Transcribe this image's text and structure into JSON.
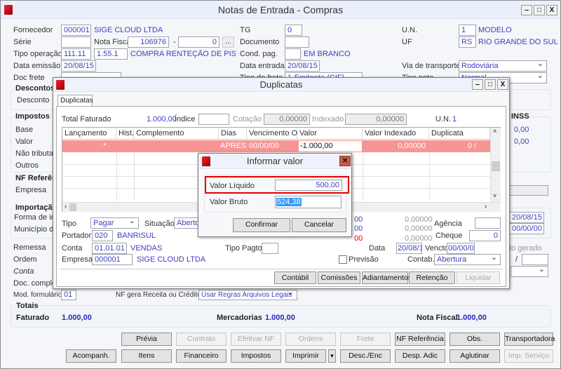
{
  "window": {
    "title": "Notas de Entrada - Compras",
    "min": "‒",
    "max": "□",
    "close": "X"
  },
  "form": {
    "fornecedor_label": "Fornecedor",
    "fornecedor_code": "000001",
    "fornecedor_name": "SIGE CLOUD LTDA",
    "tg_label": "TG",
    "tg_value": "0",
    "un_label": "U.N.",
    "un_value": "1",
    "un_name": "MODELO",
    "serie_label": "Série",
    "serie_value": "",
    "nota_fiscal_label": "Nota Fiscal",
    "nota_fiscal_value": "106976",
    "dash": "-",
    "nota_fiscal_suffix": "0",
    "ellipsis": "...",
    "documento_label": "Documento",
    "documento_value": "",
    "uf_label": "UF",
    "uf_value": "RS",
    "uf_name": "RIO GRANDE DO SUL",
    "tipo_operacao_label": "Tipo operação",
    "tipo_operacao_code": "111.11",
    "cfop": "1.55.1",
    "tipo_operacao_name": "COMPRA RENTEÇÃO DE PIS + COFI",
    "cond_pag_label": "Cond. pag.",
    "cond_pag_value": "",
    "cond_pag_name": "EM BRANCO",
    "data_emissao_label": "Data emissão",
    "data_emissao_value": "20/08/15",
    "data_entrada_label": "Data entrada",
    "data_entrada_value": "20/08/15",
    "via_transporte_label": "Via de transporte",
    "via_transporte_value": "Rodoviária",
    "doc_frete_label": "Doc frete",
    "tipo_frete_label": "Tipo de frete",
    "tipo_frete_value": "1-Emitente (CIF)",
    "tipo_nota_label": "Tipo nota",
    "tipo_nota_value": "Normal",
    "descontos_title": "Descontos",
    "desconto_label": "Desconto",
    "impostos_title": "Impostos",
    "base_label": "Base",
    "valor_label": "Valor",
    "nao_tributado_label": "Não tributado",
    "outros_label": "Outros",
    "inss_title": "INSS",
    "inss_base": "0,00",
    "inss_valor": "0,00",
    "nf_referencia_title": "NF Referência",
    "empresa_label": "Empresa",
    "importacao_title": "Importação",
    "forma_imp_label": "Forma de importação",
    "municipio_label": "Município desembaraço",
    "date1": "20/08/15",
    "date2": "00/00/00",
    "remessa_label": "Remessa",
    "ordem_label": "Ordem",
    "conta_label": "Conta",
    "doc_completo_label": "Doc. completo",
    "pedido_gerado_label": "Pedido gerado",
    "slash": "/",
    "mod_formulario_label": "Mod. formulário",
    "mod_formulario_value": "01",
    "nf_gera_label": "NF gera Receita ou Crédito",
    "nf_gera_value": "Usar Regras Arquivos Legais"
  },
  "totais": {
    "title": "Totais",
    "faturado_label": "Faturado",
    "faturado_value": "1.000,00",
    "mercadorias_label": "Mercadorias",
    "mercadorias_value": "1.000,00",
    "nota_fiscal_label": "Nota Fiscal",
    "nota_fiscal_value": "1.000,00"
  },
  "buttons_row1": [
    "Prévia",
    "Contrato",
    "Efetivar NF",
    "Ordens",
    "Frete",
    "NF Referência",
    "Obs.",
    "Transportadora"
  ],
  "buttons_row2": [
    "Acompanh.",
    "Itens",
    "Financeiro",
    "Impostos",
    "Imprimir",
    "Desc./Enc",
    "Desp. Adic",
    "Aglutinar",
    "Imp. Serviço"
  ],
  "duplicatas": {
    "title": "Duplicatas",
    "tab": "Duplicatas",
    "total_faturado_label": "Total Faturado",
    "total_faturado_value": "1.000,00",
    "indice_label": "Índice",
    "indice_value": "",
    "cotacao_label": "Cotação",
    "cotacao_value": "0,00000",
    "indexado_label": "Indexado",
    "indexado_value": "0,00000",
    "un_label": "U.N.",
    "un_value": "1",
    "columns": [
      "Lançamento",
      "Hist.",
      "Complemento",
      "Dias",
      "Vencimento Orig.",
      "Valor",
      "Valor Indexado",
      "Duplicata"
    ],
    "row": {
      "lancamento": "*",
      "hist": "",
      "complemento": "",
      "dias": "APRES",
      "vencimento": "00/00/00",
      "valor": "-1.000,00",
      "valor_indexado": "0,00000",
      "duplicata": "0 /"
    },
    "row_color": "#f79494",
    "tipo_label": "Tipo",
    "tipo_value": "Pagar",
    "situacao_label": "Situação",
    "situacao_value": "Aberto",
    "portador_label": "Portador",
    "portador_code": "020",
    "portador_name": "BANRISUL",
    "conta_label": "Conta",
    "conta_code": "01.01.01",
    "conta_name": "VENDAS",
    "empresa_label": "Empresa",
    "empresa_code": "000001",
    "empresa_name": "SIGE CLOUD LTDA",
    "tipo_pagto_label": "Tipo Pagto.",
    "tipo_pagto_value": "",
    "partial_values": [
      "00",
      "00",
      "00"
    ],
    "zero_values": [
      "0,00000",
      "0,00000",
      "0,00000"
    ],
    "agencia_label": "Agência",
    "agencia_value": "",
    "cheque_label": "Cheque",
    "cheque_value": "0",
    "data_label": "Data",
    "data_value": "20/08/15",
    "vencto_label": "Vencto.",
    "vencto_value": "00/00/00",
    "previsao_label": "Previsão",
    "previsao_checked": false,
    "contab_label": "Contab.",
    "contab_value": "Abertura",
    "buttons": [
      "Contábil",
      "Comissões",
      "Adiantamentos",
      "Retenção",
      "Liquidar"
    ]
  },
  "informar": {
    "title": "Informar valor",
    "valor_liquido_label": "Valor Líquido",
    "valor_liquido_value": "500,00",
    "valor_bruto_label": "Valor Bruto",
    "valor_bruto_value": "524,38",
    "confirmar": "Confirmar",
    "cancelar": "Cancelar",
    "highlight_color": "#e00000"
  }
}
